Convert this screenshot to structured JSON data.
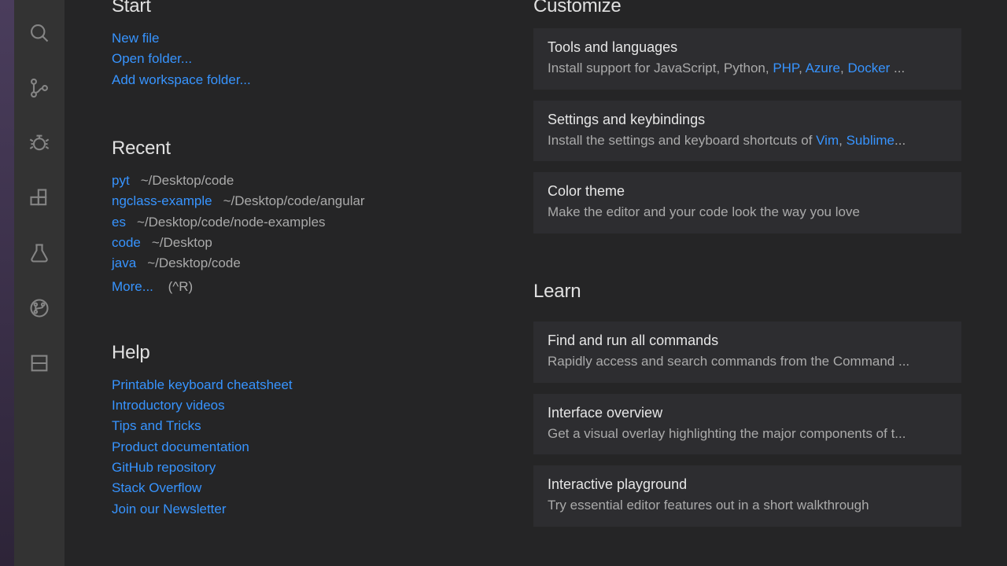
{
  "start": {
    "heading": "Start",
    "links": [
      "New file",
      "Open folder...",
      "Add workspace folder..."
    ]
  },
  "recent": {
    "heading": "Recent",
    "items": [
      {
        "name": "pyt",
        "path": "~/Desktop/code"
      },
      {
        "name": "ngclass-example",
        "path": "~/Desktop/code/angular"
      },
      {
        "name": "es",
        "path": "~/Desktop/code/node-examples"
      },
      {
        "name": "code",
        "path": "~/Desktop"
      },
      {
        "name": "java",
        "path": "~/Desktop/code"
      }
    ],
    "more": "More...",
    "more_shortcut": "(^R)"
  },
  "help": {
    "heading": "Help",
    "links": [
      "Printable keyboard cheatsheet",
      "Introductory videos",
      "Tips and Tricks",
      "Product documentation",
      "GitHub repository",
      "Stack Overflow",
      "Join our Newsletter"
    ]
  },
  "customize": {
    "heading": "Customize",
    "cards": [
      {
        "title": "Tools and languages",
        "desc_prefix": "Install support for JavaScript, Python, ",
        "desc_links": [
          "PHP",
          "Azure",
          "Docker"
        ],
        "desc_suffix": " ..."
      },
      {
        "title": "Settings and keybindings",
        "desc_prefix": "Install the settings and keyboard shortcuts of ",
        "desc_links": [
          "Vim",
          "Sublime"
        ],
        "desc_suffix": "..."
      },
      {
        "title": "Color theme",
        "desc_plain": "Make the editor and your code look the way you love"
      }
    ]
  },
  "learn": {
    "heading": "Learn",
    "cards": [
      {
        "title": "Find and run all commands",
        "desc_plain": "Rapidly access and search commands from the Command ..."
      },
      {
        "title": "Interface overview",
        "desc_plain": "Get a visual overlay highlighting the major components of t..."
      },
      {
        "title": "Interactive playground",
        "desc_plain": "Try essential editor features out in a short walkthrough"
      }
    ]
  }
}
